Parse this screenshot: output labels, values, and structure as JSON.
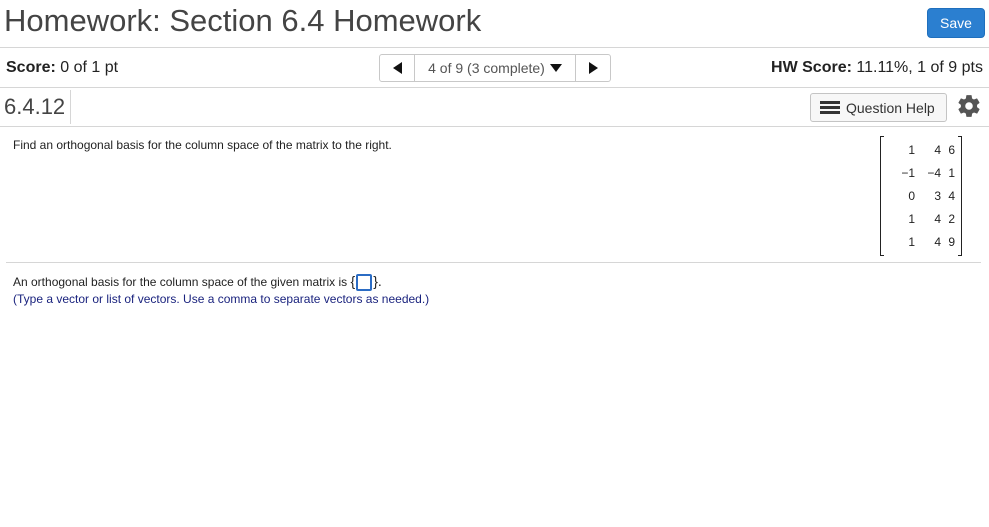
{
  "header": {
    "title": "Homework: Section 6.4 Homework",
    "save_label": "Save"
  },
  "score_bar": {
    "score_label": "Score:",
    "score_value": "0 of 1 pt",
    "pager_text": "4 of 9 (3 complete)",
    "hw_score_label": "HW Score:",
    "hw_score_value": "11.11%, 1 of 9 pts"
  },
  "question_bar": {
    "number": "6.4.12",
    "help_label": "Question Help",
    "settings_icon": "gear-icon",
    "help_icon": "list-icon"
  },
  "question": {
    "prompt": "Find an orthogonal basis for the column space of the matrix to the right.",
    "matrix": [
      [
        "1",
        "4",
        "6"
      ],
      [
        "−1",
        "−4",
        "1"
      ],
      [
        "0",
        "3",
        "4"
      ],
      [
        "1",
        "4",
        "2"
      ],
      [
        "1",
        "4",
        "9"
      ]
    ]
  },
  "answer": {
    "text": "An orthogonal basis for the column space of the given matrix is",
    "open_brace": "{",
    "close_brace": "}.",
    "hint": "(Type a vector or list of vectors. Use a comma to separate vectors as needed.)"
  },
  "colors": {
    "accent": "#2b7fd0",
    "hint_text": "#1a237e",
    "answer_box_border": "#2b6cc4"
  }
}
